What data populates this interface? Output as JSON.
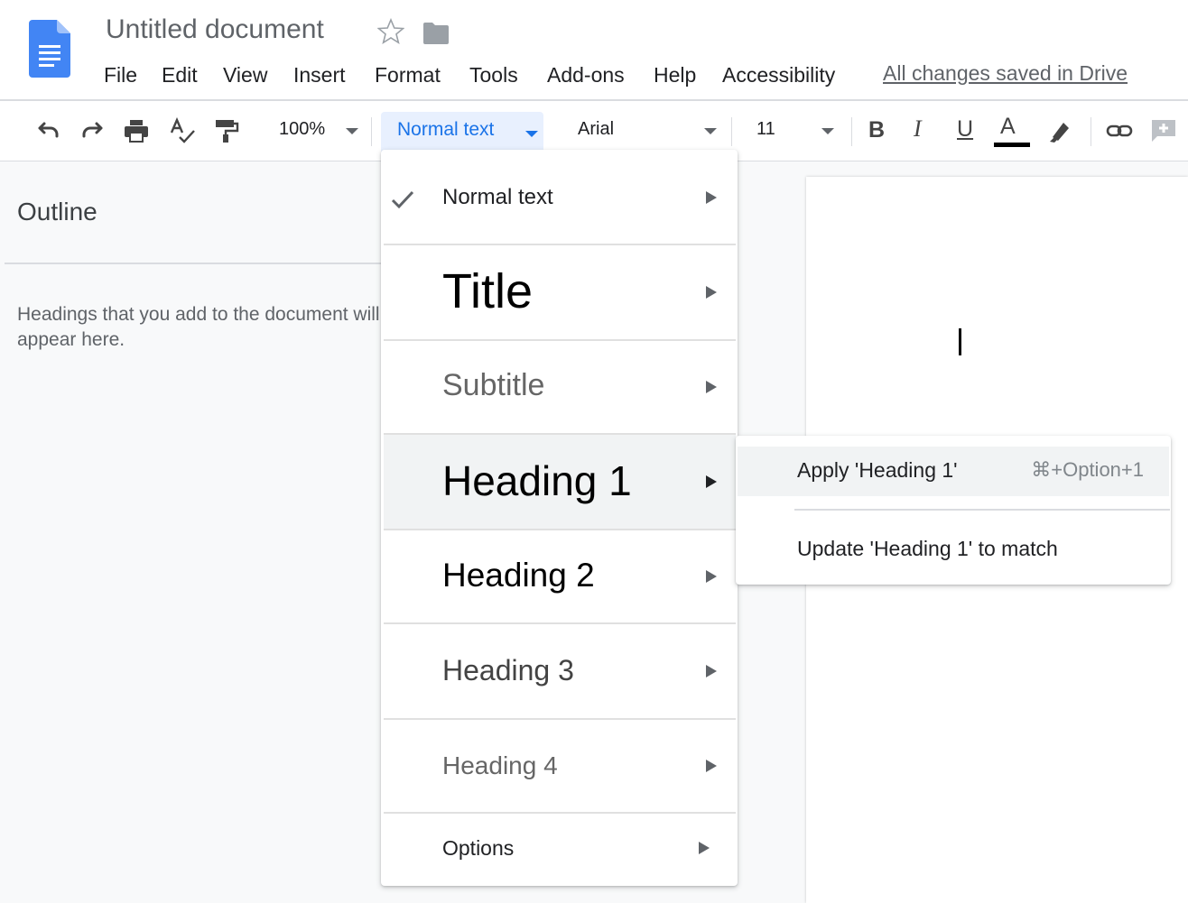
{
  "header": {
    "doc_title": "Untitled document",
    "menu": [
      "File",
      "Edit",
      "View",
      "Insert",
      "Format",
      "Tools",
      "Add-ons",
      "Help",
      "Accessibility"
    ],
    "save_status": "All changes saved in Drive"
  },
  "toolbar": {
    "zoom": "100%",
    "style": "Normal text",
    "font": "Arial",
    "font_size": "11",
    "bold": "B",
    "italic": "I",
    "underline": "U",
    "text_color_letter": "A",
    "text_color": "#000000"
  },
  "outline": {
    "title": "Outline",
    "hint": "Headings that you add to the document will appear here."
  },
  "style_menu": {
    "selected": "Normal text",
    "items": [
      {
        "label": "Normal text"
      },
      {
        "label": "Title"
      },
      {
        "label": "Subtitle"
      },
      {
        "label": "Heading 1"
      },
      {
        "label": "Heading 2"
      },
      {
        "label": "Heading 3"
      },
      {
        "label": "Heading 4"
      },
      {
        "label": "Options"
      }
    ],
    "highlighted": "Heading 1"
  },
  "submenu": {
    "apply_label": "Apply 'Heading 1'",
    "apply_shortcut": "⌘+Option+1",
    "update_label": "Update 'Heading 1' to match"
  },
  "colors": {
    "accent": "#1a73e8",
    "docs_blue": "#4285f4"
  }
}
